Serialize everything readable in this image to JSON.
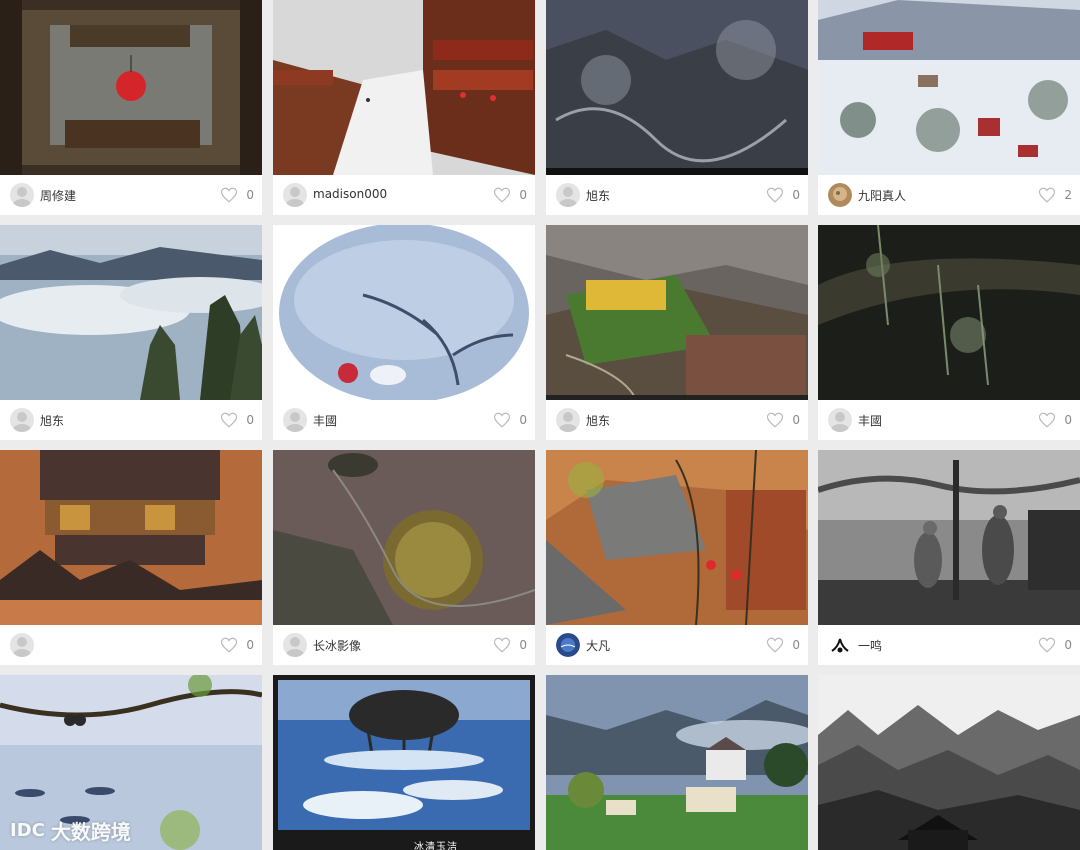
{
  "gallery": {
    "cards": [
      {
        "author": "周修建",
        "likes": "0",
        "avatar_style": "default"
      },
      {
        "author": "madison000",
        "likes": "0",
        "avatar_style": "default"
      },
      {
        "author": "旭东",
        "likes": "0",
        "avatar_style": "default"
      },
      {
        "author": "九阳真人",
        "likes": "2",
        "avatar_style": "photo"
      },
      {
        "author": "旭东",
        "likes": "0",
        "avatar_style": "default"
      },
      {
        "author": "丰國",
        "likes": "0",
        "avatar_style": "default"
      },
      {
        "author": "旭东",
        "likes": "0",
        "avatar_style": "default"
      },
      {
        "author": "丰國",
        "likes": "0",
        "avatar_style": "default"
      },
      {
        "author": "",
        "likes": "0",
        "avatar_style": "default"
      },
      {
        "author": "长冰影像",
        "likes": "0",
        "avatar_style": "default"
      },
      {
        "author": "大凡",
        "likes": "0",
        "avatar_style": "globe"
      },
      {
        "author": "一鸣",
        "likes": "0",
        "avatar_style": "ink"
      }
    ],
    "row4_captions": {
      "card14": "冰清玉洁"
    }
  },
  "watermark": {
    "logo": "IDC",
    "text": "大数跨境"
  },
  "colors": {
    "background": "#ececec",
    "card": "#ffffff",
    "text": "#333333",
    "muted": "#888888",
    "heart": "#bbbbbb"
  }
}
